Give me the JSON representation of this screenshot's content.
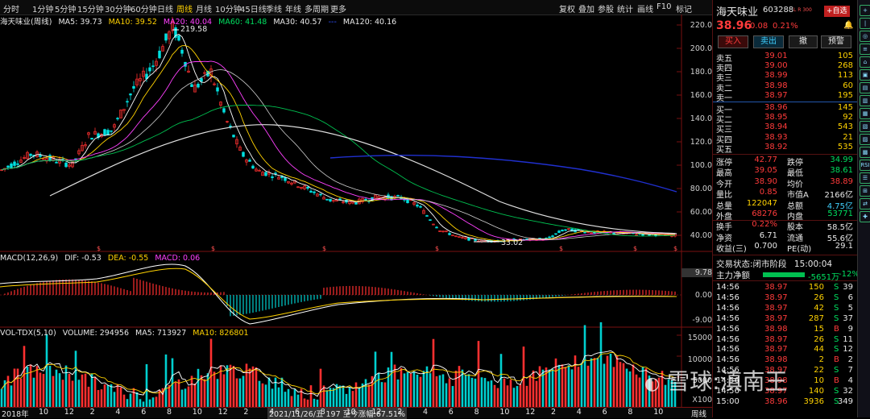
{
  "toolbar": {
    "periods": [
      "分时",
      "1分钟",
      "5分钟",
      "15分钟",
      "30分钟",
      "60分钟",
      "日线",
      "周线",
      "月线",
      "10分钟",
      "45日线",
      "季线",
      "年线",
      "多周期",
      "更多"
    ],
    "active_period": "周线",
    "right_tools": [
      "复权",
      "叠加",
      "参股",
      "统计",
      "画线",
      "F10",
      "标记"
    ]
  },
  "price_legend": {
    "name": "海天味业(周线)",
    "ma5": "MA5: 39.73",
    "ma10": "MA10: 39.52",
    "ma20": "MA20: 40.04",
    "ma60": "MA60: 41.48",
    "ma30": "MA30: 40.57",
    "ma120": "MA120: 40.16",
    "ma_hidden": "---"
  },
  "macd_legend": {
    "label": "MACD(12,26,9)",
    "dif": "DIF: -0.53",
    "dea": "DEA: -0.55",
    "macd": "MACD: 0.06"
  },
  "vol_legend": {
    "label": "VOL-TDX(5,10)",
    "volume": "VOLUME: 294956",
    "ma5": "MA5: 713927",
    "ma10": "MA10: 826801"
  },
  "price_axis": [
    "220.0",
    "200.0",
    "180.0",
    "160.0",
    "140.0",
    "120.0",
    "100.0",
    "80.00",
    "60.00",
    "40.00"
  ],
  "macd_axis": [
    "9.78",
    "0.00",
    "-9.00"
  ],
  "vol_axis": [
    "15000",
    "10000",
    "5000",
    "X100"
  ],
  "annotations": {
    "high": "219.58",
    "low": "33.02"
  },
  "bottom": {
    "year": "2018年",
    "months": [
      "10",
      "12",
      "2",
      "4",
      "6",
      "8",
      "10",
      "12",
      "2",
      "4",
      "6",
      "8",
      "10",
      "12",
      "2",
      "4",
      "6",
      "8",
      "10",
      "12",
      "2",
      "4",
      "6",
      "8",
      "10"
    ],
    "status": "2021/11/26/五 197 至今涨幅:67.51%",
    "period": "周线"
  },
  "stock": {
    "name": "海天味业",
    "code": "603288",
    "tag": "L R 300",
    "add_btn": "+自选",
    "price": "38.96",
    "change": "0.08",
    "pct": "0.21%",
    "buttons": [
      "买入",
      "卖出",
      "撤",
      "预警"
    ]
  },
  "asks": [
    {
      "label": "卖五",
      "price": "39.01",
      "vol": "105"
    },
    {
      "label": "卖四",
      "price": "39.00",
      "vol": "268"
    },
    {
      "label": "卖三",
      "price": "38.99",
      "vol": "113"
    },
    {
      "label": "卖二",
      "price": "38.98",
      "vol": "60"
    },
    {
      "label": "卖一",
      "price": "38.97",
      "vol": "195"
    }
  ],
  "bids": [
    {
      "label": "买一",
      "price": "38.96",
      "vol": "145"
    },
    {
      "label": "买二",
      "price": "38.95",
      "vol": "92"
    },
    {
      "label": "买三",
      "price": "38.94",
      "vol": "543"
    },
    {
      "label": "买四",
      "price": "38.93",
      "vol": "21"
    },
    {
      "label": "买五",
      "price": "38.92",
      "vol": "535"
    }
  ],
  "stats": [
    {
      "l1": "涨停",
      "v1": "42.77",
      "l2": "跌停",
      "v2": "34.99"
    },
    {
      "l1": "最高",
      "v1": "39.05",
      "l2": "最低",
      "v2": "38.61"
    },
    {
      "l1": "今开",
      "v1": "38.90",
      "l2": "均价",
      "v2": "38.89"
    },
    {
      "l1": "量比",
      "v1": "0.85",
      "l2": "市值A",
      "v2": "2166亿"
    },
    {
      "l1": "总量",
      "v1": "122047",
      "l2": "总额",
      "v2": "4.75亿"
    },
    {
      "l1": "外盘",
      "v1": "68276",
      "l2": "内盘",
      "v2": "53771"
    },
    {
      "l1": "换手",
      "v1": "0.22%",
      "l2": "股本",
      "v2": "58.5亿"
    },
    {
      "l1": "净资",
      "v1": "6.71",
      "l2": "流通",
      "v2": "55.6亿"
    },
    {
      "l1": "收益(三)",
      "v1": "0.700",
      "l2": "PE(动)",
      "v2": "29.1"
    }
  ],
  "trade_status": {
    "label": "交易状态:",
    "value": "闭市阶段",
    "time": "15:00:04"
  },
  "main_net": {
    "label": "主力净额",
    "value": "-5651万",
    "pct": "-12%"
  },
  "ticks": [
    {
      "t": "14:56",
      "p": "38.97",
      "v": "150",
      "d": "S",
      "n": "39"
    },
    {
      "t": "14:56",
      "p": "38.97",
      "v": "26",
      "d": "S",
      "n": "6"
    },
    {
      "t": "14:56",
      "p": "38.97",
      "v": "42",
      "d": "S",
      "n": "5"
    },
    {
      "t": "14:56",
      "p": "38.97",
      "v": "287",
      "d": "S",
      "n": "37"
    },
    {
      "t": "14:56",
      "p": "38.98",
      "v": "15",
      "d": "B",
      "n": "9"
    },
    {
      "t": "14:56",
      "p": "38.97",
      "v": "26",
      "d": "S",
      "n": "11"
    },
    {
      "t": "14:56",
      "p": "38.97",
      "v": "44",
      "d": "S",
      "n": "12"
    },
    {
      "t": "14:56",
      "p": "38.98",
      "v": "2",
      "d": "B",
      "n": "2"
    },
    {
      "t": "14:56",
      "p": "38.97",
      "v": "22",
      "d": "S",
      "n": "7"
    },
    {
      "t": "14:56",
      "p": "38.98",
      "v": "10",
      "d": "B",
      "n": "4"
    },
    {
      "t": "14:56",
      "p": "38.97",
      "v": "140",
      "d": "S",
      "n": "32"
    },
    {
      "t": "15:00",
      "p": "38.96",
      "v": "3936",
      "d": "S",
      "n": "349"
    }
  ],
  "watermark": "雪球:滇南王",
  "sidebar_icons": [
    "+",
    "|",
    "◎",
    "≡",
    "⌂",
    "▣",
    "▤",
    "▥",
    "▦",
    "▧",
    "▨",
    "▩",
    "RSI",
    "☰",
    "⊞",
    "⇄",
    "✚"
  ]
}
